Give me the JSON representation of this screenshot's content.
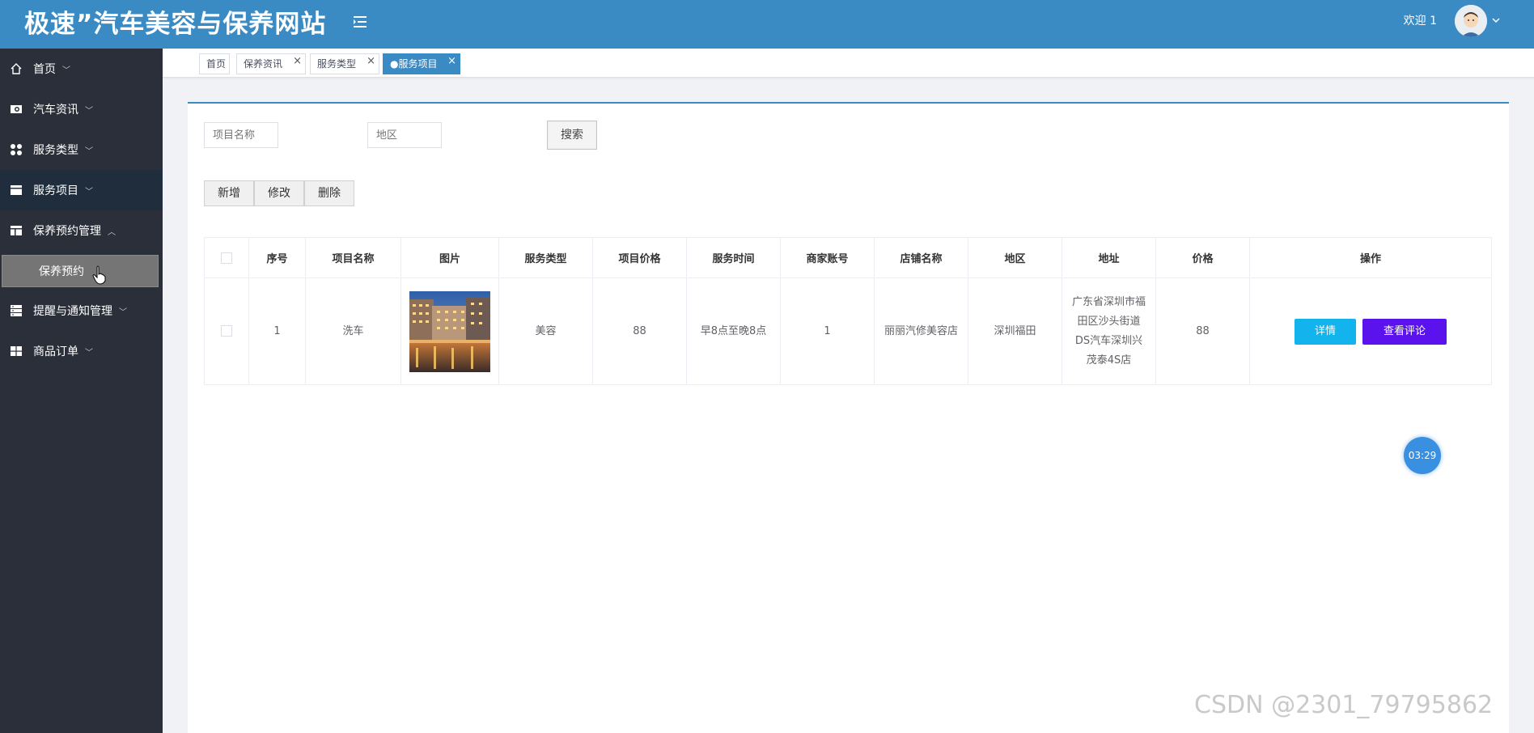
{
  "header": {
    "title": "极速”汽车美容与保养网站",
    "welcome": "欢迎 1"
  },
  "sidebar": {
    "items": [
      {
        "label": "首页",
        "icon": "home-icon"
      },
      {
        "label": "汽车资讯",
        "icon": "news-icon"
      },
      {
        "label": "服务类型",
        "icon": "grid-icon"
      },
      {
        "label": "服务项目",
        "icon": "list-icon"
      },
      {
        "label": "保养预约管理",
        "icon": "layout-icon"
      },
      {
        "label": "提醒与通知管理",
        "icon": "stack-icon"
      },
      {
        "label": "商品订单",
        "icon": "table-icon"
      }
    ],
    "sub_item": "保养预约"
  },
  "tabs": [
    {
      "label": "首页"
    },
    {
      "label": "保养资讯"
    },
    {
      "label": "服务类型"
    },
    {
      "label": "●服务项目"
    }
  ],
  "search": {
    "name_placeholder": "项目名称",
    "region_placeholder": "地区",
    "button": "搜索"
  },
  "toolbar": {
    "add": "新增",
    "edit": "修改",
    "delete": "删除"
  },
  "table": {
    "columns": [
      "序号",
      "项目名称",
      "图片",
      "服务类型",
      "项目价格",
      "服务时间",
      "商家账号",
      "店铺名称",
      "地区",
      "地址",
      "价格",
      "操作"
    ],
    "rows": [
      {
        "index": "1",
        "name": "洗车",
        "service_type": "美容",
        "item_price": "88",
        "service_time": "早8点至晚8点",
        "merchant_account": "1",
        "shop_name": "丽丽汽修美容店",
        "region": "深圳福田",
        "address": "广东省深圳市福田区沙头街道DS汽车深圳兴茂泰4S店",
        "price": "88",
        "detail_btn": "详情",
        "comment_btn": "查看评论"
      }
    ]
  },
  "timer": "03:29",
  "watermark": "CSDN @2301_79795862",
  "colors": {
    "header": "#3a8ac4",
    "sidebar": "#2b2f3a",
    "detail_button": "#13b3ee",
    "comment_button": "#5b13ee"
  }
}
